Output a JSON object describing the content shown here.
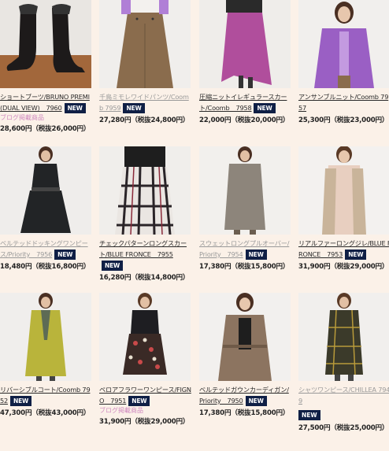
{
  "products": [
    {
      "name": "ショートブーツ/BRUNO PREMI (DUAL VIEW)　7960",
      "badge": "NEW",
      "blog": "ブログ掲載商品",
      "price": "28,600円（税抜26,000円）",
      "faded": false
    },
    {
      "name": "千鳥ミモレワイドパンツ/Coomb 7959",
      "badge": "NEW",
      "blog": "",
      "price": "27,280円（税抜24,800円）",
      "faded": true
    },
    {
      "name": "圧縮ニットイレギュラースカート/Coomb　7958",
      "badge": "NEW",
      "blog": "",
      "price": "22,000円（税抜20,000円）",
      "faded": false
    },
    {
      "name": "アンサンブルニット/Coomb 7957",
      "badge": "NEW",
      "blog": "",
      "price": "25,300円（税抜23,000円）",
      "faded": false
    },
    {
      "name": "ベルテッドドッキングワンピース/Priority　7956",
      "badge": "NEW",
      "blog": "",
      "price": "18,480円（税抜16,800円）",
      "faded": true
    },
    {
      "name": "チェックパターンロングスカート/BLUE FRONCE　7955",
      "badge": "NEW",
      "blog": "",
      "price": "16,280円（税抜14,800円）",
      "faded": false
    },
    {
      "name": "スウェットロングプルオーバー/Priority　7954",
      "badge": "NEW",
      "blog": "",
      "price": "17,380円（税抜15,800円）",
      "faded": true
    },
    {
      "name": "リアルファーロングジレ/BLUE FRONCE　7953",
      "badge": "NEW",
      "blog": "",
      "price": "31,900円（税抜29,000円）",
      "faded": false
    },
    {
      "name": "リバーシブルコート/Coomb 7952",
      "badge": "NEW",
      "blog": "",
      "price": "47,300円（税抜43,000円）",
      "faded": false
    },
    {
      "name": "ペロアフラワーワンピース/FIGNO　7951",
      "badge": "NEW",
      "blog": "ブログ掲載商品",
      "price": "31,900円（税抜29,000円）",
      "faded": false
    },
    {
      "name": "ベルテッドガウンカーディガン/Priority　7950",
      "badge": "NEW",
      "blog": "",
      "price": "17,380円（税抜15,800円）",
      "faded": false
    },
    {
      "name": "シャツワンピース/CHILLEA 7949",
      "badge": "NEW",
      "blog": "",
      "price": "27,500円（税抜25,000円）",
      "faded": true
    }
  ],
  "photo_colors": {
    "boots": "#1d1a1a",
    "pants": "#8a6c4d",
    "skirt_pink": "#b04e9c",
    "knit_purple": "#9a5fc4",
    "dress_black": "#222426",
    "check": "#2a2428",
    "sweat": "#8d857b",
    "fur": "#c9b49a",
    "coat_yellow": "#b9b43b",
    "floral": "#3a2a26",
    "cardigan": "#8c7460",
    "shirt_check": "#3b3a2a"
  }
}
